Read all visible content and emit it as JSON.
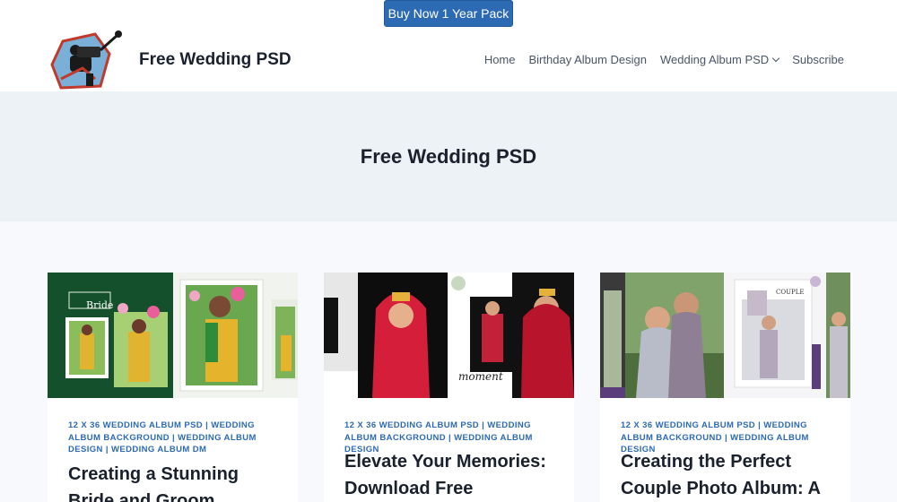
{
  "topbar": {
    "buy_label": "Buy Now 1 Year Pack"
  },
  "header": {
    "site_title": "Free Wedding PSD",
    "nav": [
      {
        "label": "Home"
      },
      {
        "label": "Birthday Album Design"
      },
      {
        "label": "Wedding Album PSD",
        "icon": "chevron-down-icon"
      },
      {
        "label": "Subscribe"
      }
    ]
  },
  "hero": {
    "title": "Free Wedding PSD"
  },
  "posts": [
    {
      "categories": [
        "12 X 36 Wedding Album PSD",
        "Wedding Album Background",
        "Wedding Album Design",
        "Wedding Album DM"
      ],
      "image_text": "Bride",
      "title": "Creating a Stunning Bride and Groom"
    },
    {
      "categories": [
        "12 X 36 Wedding Album PSD",
        "Wedding Album Background",
        "Wedding Album Design"
      ],
      "image_text": "moment",
      "title": "Elevate Your Memories: Download Free"
    },
    {
      "categories": [
        "12 X 36 Wedding Album PSD",
        "Wedding Album Background",
        "Wedding Album Design"
      ],
      "image_text": "COUPLE",
      "title": "Creating the Perfect Couple Photo Album: A"
    }
  ],
  "colors": {
    "accent": "#2d6ab4",
    "hero_bg": "#edf2f7",
    "page_bg": "#f7f9fc"
  }
}
